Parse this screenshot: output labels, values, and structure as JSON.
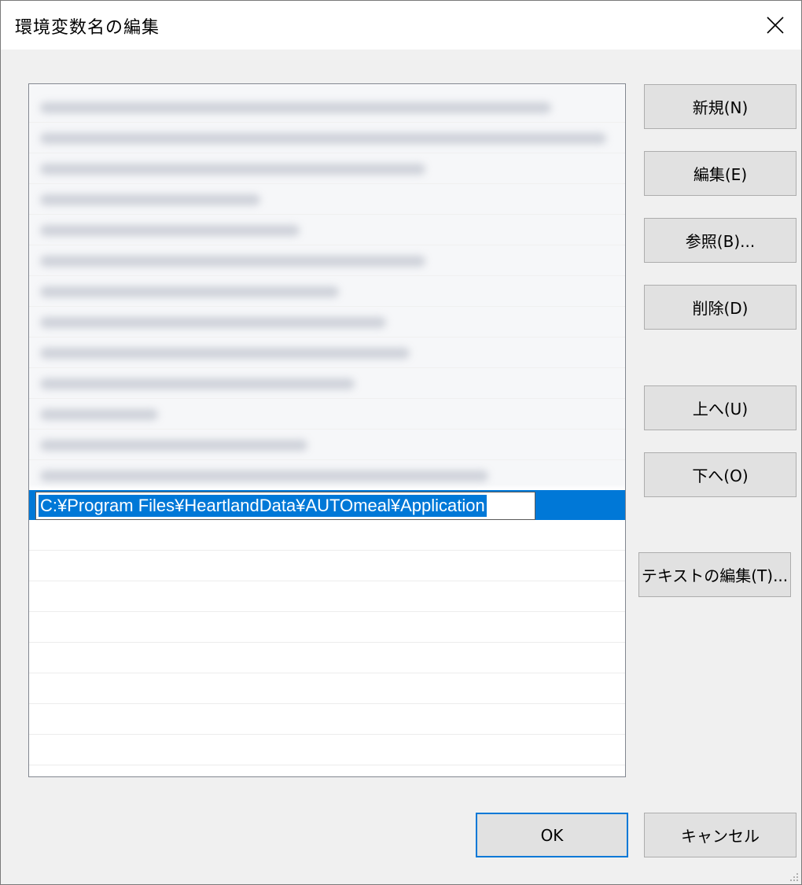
{
  "window": {
    "title": "環境変数名の編集",
    "close_icon": "close-icon"
  },
  "list": {
    "blurred_entry_count": 13,
    "selected_entry_value": "C:¥Program Files¥HeartlandData¥AUTOmeal¥Application"
  },
  "buttons": {
    "new": "新規(N)",
    "edit": "編集(E)",
    "browse": "参照(B)...",
    "delete": "削除(D)",
    "move_up": "上へ(U)",
    "move_down": "下へ(O)",
    "edit_text": "テキストの編集(T)...",
    "ok": "OK",
    "cancel": "キャンセル"
  },
  "colors": {
    "accent": "#0078d7",
    "button_face": "#e1e1e1",
    "dialog_bg": "#f0f0f0"
  }
}
